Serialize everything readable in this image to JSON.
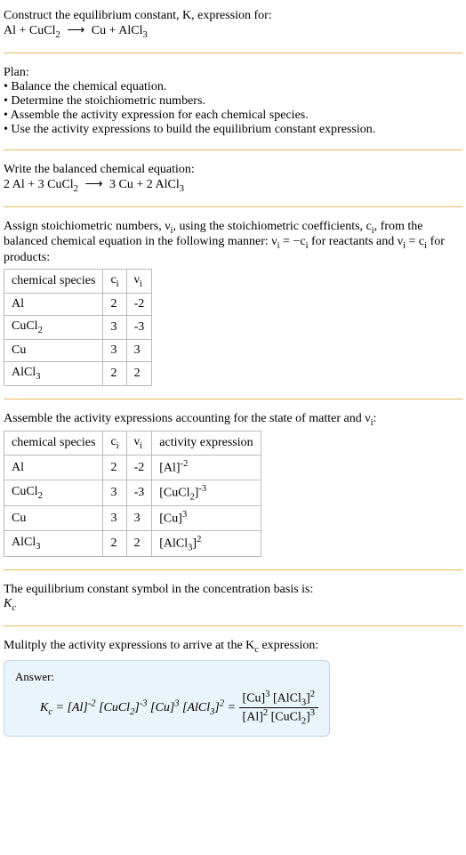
{
  "prompt": {
    "line1": "Construct the equilibrium constant, K, expression for:",
    "equation_html": "Al + CuCl<sub>2</sub> <span class='eq-arrow'>⟶</span> Cu + AlCl<sub>3</sub>"
  },
  "plan": {
    "heading": "Plan:",
    "items": [
      "Balance the chemical equation.",
      "Determine the stoichiometric numbers.",
      "Assemble the activity expression for each chemical species.",
      "Use the activity expressions to build the equilibrium constant expression."
    ]
  },
  "balanced": {
    "heading": "Write the balanced chemical equation:",
    "equation_html": "2 Al + 3 CuCl<sub>2</sub> <span class='eq-arrow'>⟶</span> 3 Cu + 2 AlCl<sub>3</sub>"
  },
  "stoich": {
    "intro_html": "Assign stoichiometric numbers, ν<sub>i</sub>, using the stoichiometric coefficients, c<sub>i</sub>, from the balanced chemical equation in the following manner: ν<sub>i</sub> = −c<sub>i</sub> for reactants and ν<sub>i</sub> = c<sub>i</sub> for products:",
    "headers": {
      "species": "chemical species",
      "ci_html": "c<sub>i</sub>",
      "vi_html": "ν<sub>i</sub>"
    },
    "rows": [
      {
        "species_html": "Al",
        "ci": "2",
        "vi": "-2"
      },
      {
        "species_html": "CuCl<sub>2</sub>",
        "ci": "3",
        "vi": "-3"
      },
      {
        "species_html": "Cu",
        "ci": "3",
        "vi": "3"
      },
      {
        "species_html": "AlCl<sub>3</sub>",
        "ci": "2",
        "vi": "2"
      }
    ]
  },
  "activity": {
    "intro_html": "Assemble the activity expressions accounting for the state of matter and ν<sub>i</sub>:",
    "headers": {
      "species": "chemical species",
      "ci_html": "c<sub>i</sub>",
      "vi_html": "ν<sub>i</sub>",
      "act": "activity expression"
    },
    "rows": [
      {
        "species_html": "Al",
        "ci": "2",
        "vi": "-2",
        "act_html": "[Al]<sup>-2</sup>"
      },
      {
        "species_html": "CuCl<sub>2</sub>",
        "ci": "3",
        "vi": "-3",
        "act_html": "[CuCl<sub>2</sub>]<sup>-3</sup>"
      },
      {
        "species_html": "Cu",
        "ci": "3",
        "vi": "3",
        "act_html": "[Cu]<sup>3</sup>"
      },
      {
        "species_html": "AlCl<sub>3</sub>",
        "ci": "2",
        "vi": "2",
        "act_html": "[AlCl<sub>3</sub>]<sup>2</sup>"
      }
    ]
  },
  "symbol": {
    "line1": "The equilibrium constant symbol in the concentration basis is:",
    "symbol_html": "K<sub>c</sub>"
  },
  "multiply": {
    "line_html": "Mulitply the activity expressions to arrive at the K<sub>c</sub> expression:"
  },
  "answer": {
    "label": "Answer:",
    "lhs_html": "K<sub>c</sub> = [Al]<sup>-2</sup> [CuCl<sub>2</sub>]<sup>-3</sup> [Cu]<sup>3</sup> [AlCl<sub>3</sub>]<sup>2</sup> = ",
    "num_html": "[Cu]<sup>3</sup> [AlCl<sub>3</sub>]<sup>2</sup>",
    "den_html": "[Al]<sup>2</sup> [CuCl<sub>2</sub>]<sup>3</sup>"
  }
}
